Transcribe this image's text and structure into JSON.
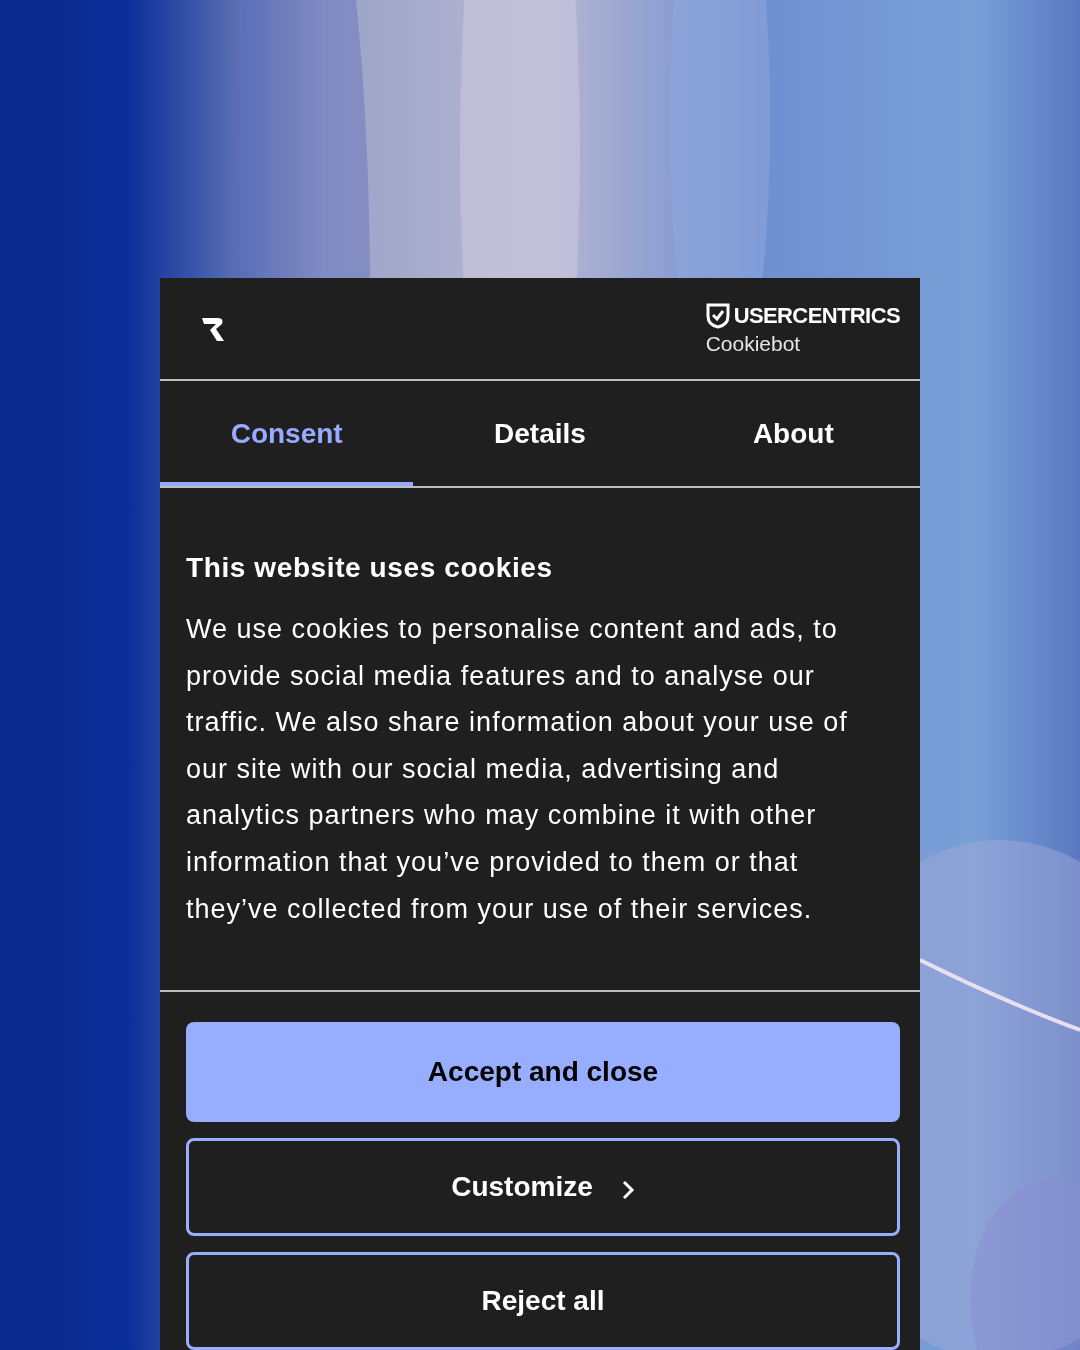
{
  "brand": {
    "name": "USERCENTRICS",
    "product": "Cookiebot"
  },
  "tabs": [
    {
      "label": "Consent",
      "selected": true
    },
    {
      "label": "Details",
      "selected": false
    },
    {
      "label": "About",
      "selected": false
    }
  ],
  "heading": "This website uses cookies",
  "body": "We use cookies to personalise content and ads, to provide social media features and to analyse our traffic. We also share information about your use of our site with our social media, advertising and analytics partners who may combine it with other information that you’ve provided to them or that they’ve collected from your use of their services.",
  "buttons": [
    {
      "label": "Accept and close",
      "kind": "primary"
    },
    {
      "label": "Customize",
      "kind": "chevron"
    },
    {
      "label": "Reject all",
      "kind": "outline"
    }
  ]
}
